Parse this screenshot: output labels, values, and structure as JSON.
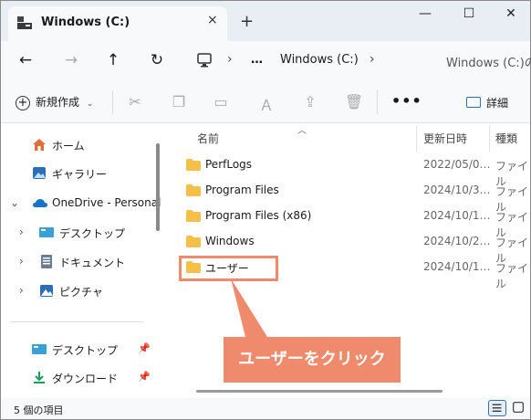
{
  "tab": {
    "title": "Windows (C:)",
    "close_icon": "×",
    "new_tab_icon": "+"
  },
  "window_controls": {
    "minimize": "—",
    "maximize": "☐",
    "close": "✕"
  },
  "nav": {
    "back": "←",
    "forward": "→",
    "up": "↑",
    "refresh": "↻"
  },
  "address": {
    "more": "…",
    "crumb": "Windows (C:)",
    "search_placeholder": "Windows (C:)の"
  },
  "toolbar": {
    "new_label": "新規作成",
    "more": "•••",
    "details_label": "詳細"
  },
  "sidebar": {
    "items": [
      {
        "label": "ホーム"
      },
      {
        "label": "ギャラリー"
      },
      {
        "label": "OneDrive - Personal"
      },
      {
        "label": "デスクトップ"
      },
      {
        "label": "ドキュメント"
      },
      {
        "label": "ピクチャ"
      }
    ],
    "quick": [
      {
        "label": "デスクトップ"
      },
      {
        "label": "ダウンロード"
      }
    ]
  },
  "columns": {
    "name": "名前",
    "modified": "更新日時",
    "type": "種類"
  },
  "rows": [
    {
      "name": "PerfLogs",
      "date": "2022/05/0…",
      "type": "ファイル"
    },
    {
      "name": "Program Files",
      "date": "2024/10/3…",
      "type": "ファイル"
    },
    {
      "name": "Program Files (x86)",
      "date": "2024/10/1…",
      "type": "ファイル"
    },
    {
      "name": "Windows",
      "date": "2024/10/2…",
      "type": "ファイル"
    },
    {
      "name": "ユーザー",
      "date": "2024/10/1…",
      "type": "ファイル"
    }
  ],
  "status": {
    "count_text": "5 個の項目"
  },
  "callout": {
    "text": "ユーザーをクリック"
  },
  "colors": {
    "accent": "#f08a6c",
    "folder": "#f5c04a",
    "link_blue": "#2c6fb7"
  }
}
